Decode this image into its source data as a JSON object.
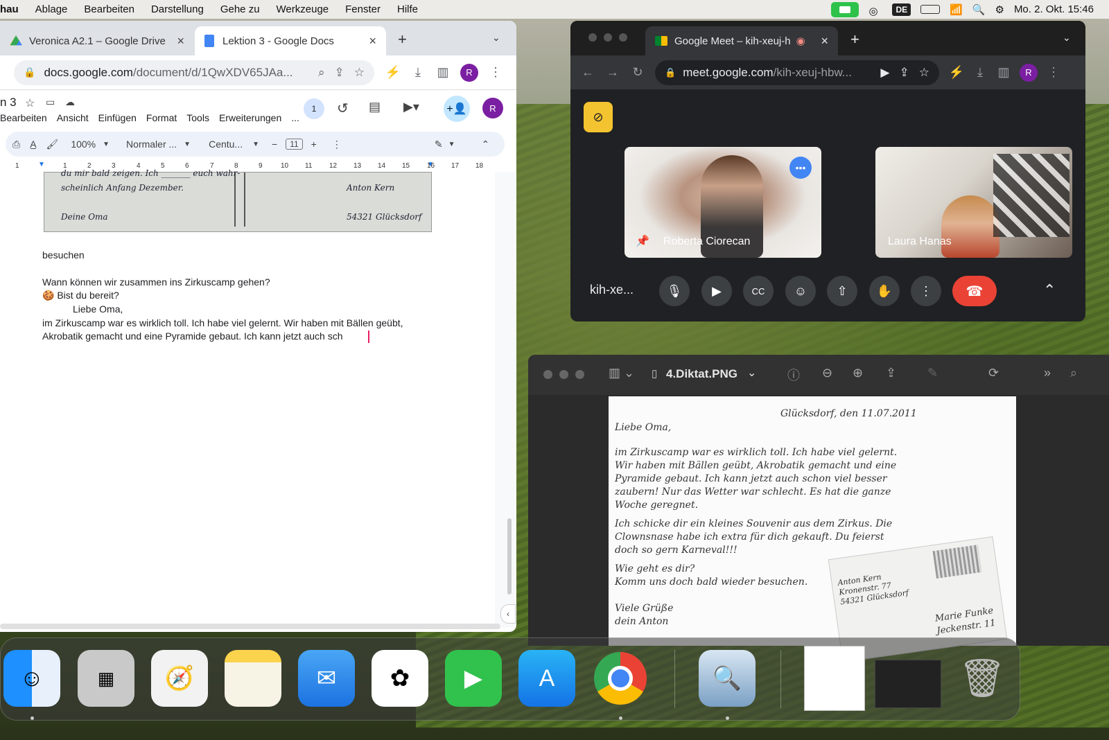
{
  "menubar": {
    "app": "hau",
    "items": [
      "Ablage",
      "Bearbeiten",
      "Darstellung",
      "Gehe zu",
      "Werkzeuge",
      "Fenster",
      "Hilfe"
    ],
    "lang": "DE",
    "clock": "Mo. 2. Okt.  15:46"
  },
  "docs_window": {
    "tabs": [
      {
        "label": "Veronica A2.1 – Google Drive"
      },
      {
        "label": "Lektion 3 - Google Docs"
      }
    ],
    "url_main": "docs.google.com",
    "url_rest": "/document/d/1QwXDV65JAa...",
    "profile": "R",
    "doc_title": "n 3",
    "menu": [
      "Bearbeiten",
      "Ansicht",
      "Einfügen",
      "Format",
      "Tools",
      "Erweiterungen",
      "..."
    ],
    "comment_count": "1",
    "toolbar": {
      "zoom": "100%",
      "style": "Normaler ...",
      "font": "Centu...",
      "size": "11"
    },
    "ruler_numbers": [
      "1",
      "1",
      "2",
      "3",
      "4",
      "5",
      "6",
      "7",
      "8",
      "9",
      "10",
      "11",
      "12",
      "13",
      "14",
      "15",
      "16",
      "17",
      "18"
    ],
    "postcard": {
      "line1": "du mir bald zeigen. Ich _______ euch wahr-",
      "line2": "scheinlich Anfang Dezember.",
      "sign": "Deine Oma",
      "addr_name": "Anton Kern",
      "addr_city": "54321 Glücksdorf"
    },
    "body": {
      "word": "besuchen",
      "q1": "Wann können wir zusammen ins Zirkuscamp gehen?",
      "q2": "🍪 Bist du bereit?",
      "greeting": "Liebe Oma,",
      "p1": "im Zirkuscamp war es wirklich toll. Ich habe viel gelernt. Wir haben mit Bällen geübt,",
      "p2": "Akrobatik gemacht und eine Pyramide gebaut. Ich kann jetzt auch sch"
    }
  },
  "meet_window": {
    "tab_label": "Google Meet – kih-xeuj-h",
    "url_main": "meet.google.com",
    "url_rest": "/kih-xeuj-hbw...",
    "profile": "R",
    "participants": [
      {
        "name": "Roberta Ciorecan"
      },
      {
        "name": "Laura Hanas"
      }
    ],
    "meeting_code": "kih-xe...",
    "colors": {
      "end_call": "#ea4335",
      "badge": "#f4c430"
    }
  },
  "preview_window": {
    "title": "4.Diktat.PNG",
    "letter": {
      "date": "Glücksdorf, den 11.07.2011",
      "greeting": "Liebe Oma,",
      "l1": "im Zirkuscamp war es wirklich toll. Ich habe viel gelernt.",
      "l2": "Wir haben mit Bällen geübt, Akrobatik gemacht und eine",
      "l3": "Pyramide gebaut. Ich kann jetzt auch schon viel besser",
      "l4": "zaubern! Nur das Wetter war schlecht. Es hat die ganze",
      "l5": "Woche geregnet.",
      "l6": "Ich schicke dir ein kleines Souvenir aus dem Zirkus. Die",
      "l7": "Clownsnase habe ich extra für dich gekauft. Du feierst",
      "l8": "doch so gern Karneval!!!",
      "l9": "Wie geht es dir?",
      "l10": "Komm uns doch bald wieder besuchen.",
      "l11": "Viele Grüße",
      "l12": "dein Anton",
      "env1": "Anton Kern",
      "env2": "Kronenstr. 77",
      "env3": "54321 Glücksdorf",
      "env4": "Marie Funke",
      "env5": "Jeckenstr. 11"
    }
  },
  "dock": {
    "apps": [
      "finder-icon",
      "launchpad-icon",
      "safari-icon",
      "notes-icon",
      "mail-icon",
      "photos-icon",
      "facetime-icon",
      "app-store-icon",
      "chrome-icon",
      "preview-icon",
      "trash-icon"
    ]
  }
}
